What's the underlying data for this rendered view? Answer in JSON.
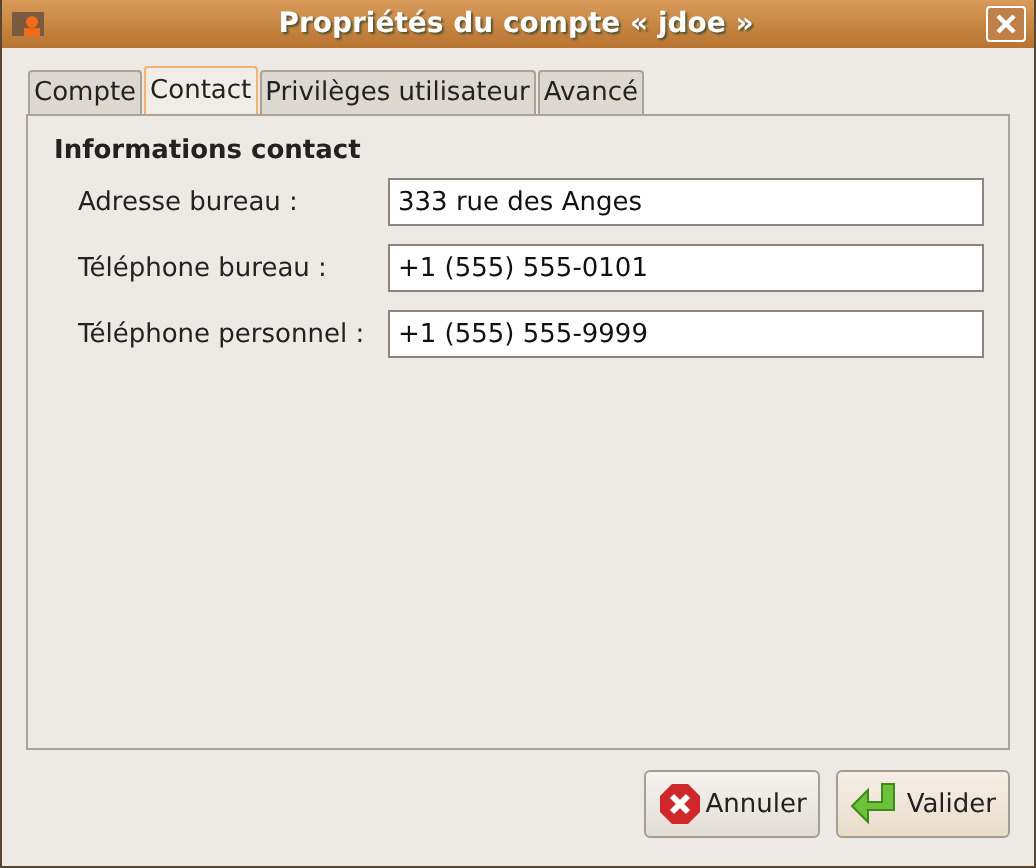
{
  "window": {
    "title": "Propriétés du compte « jdoe »"
  },
  "tabs": [
    {
      "label": "Compte",
      "selected": false
    },
    {
      "label": "Contact",
      "selected": true
    },
    {
      "label": "Privilèges utilisateur",
      "selected": false
    },
    {
      "label": "Avancé",
      "selected": false
    }
  ],
  "section": {
    "title": "Informations contact"
  },
  "fields": [
    {
      "label": "Adresse bureau :",
      "value": "333 rue des Anges"
    },
    {
      "label": "Téléphone bureau :",
      "value": "+1 (555) 555-0101"
    },
    {
      "label": "Téléphone personnel :",
      "value": "+1 (555) 555-9999"
    }
  ],
  "buttons": [
    {
      "kind": "cancel",
      "label": "Annuler",
      "selected": false
    },
    {
      "kind": "ok",
      "label": "Valider",
      "selected": true
    }
  ]
}
